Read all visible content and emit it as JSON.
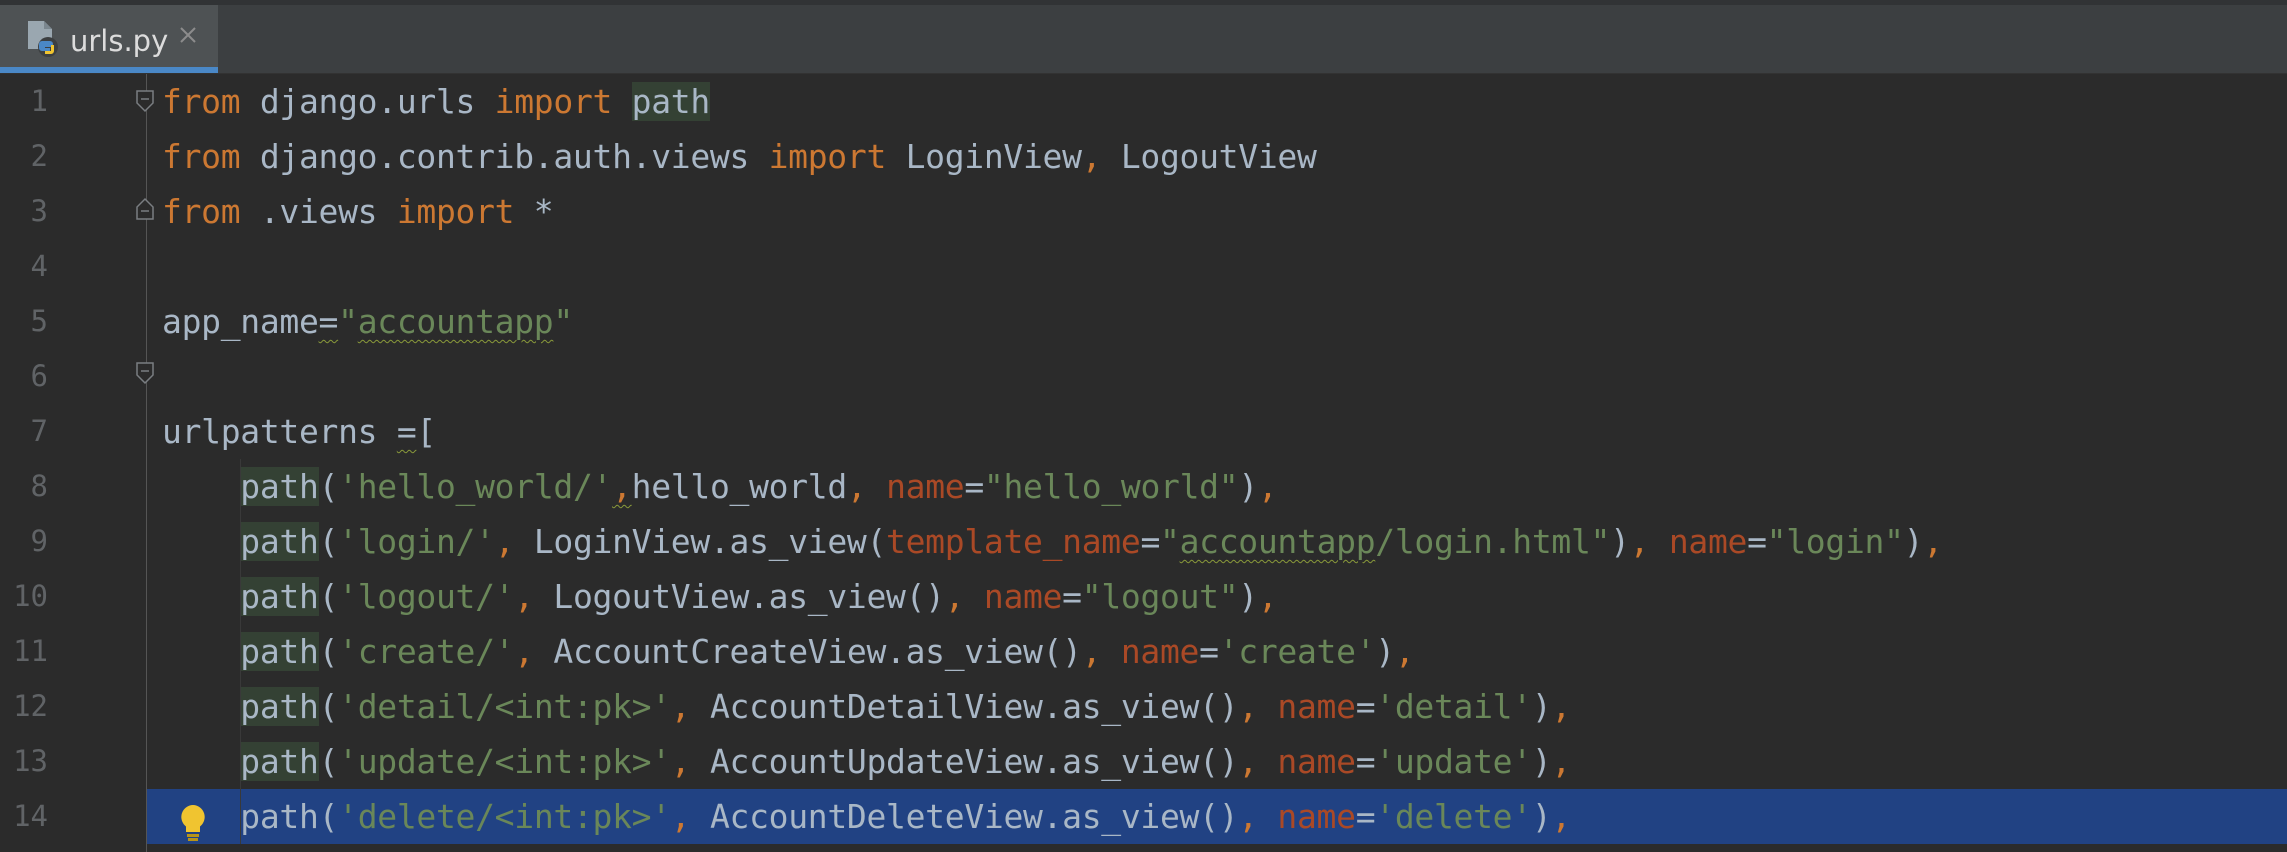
{
  "tab": {
    "filename": "urls.py",
    "icon": "python-file-icon",
    "close_glyph": "×"
  },
  "colors": {
    "background": "#2b2b2b",
    "keyword": "#cc7832",
    "string": "#6a8759",
    "param": "#aa4926",
    "identifier": "#a9b7c6",
    "selection": "#214283",
    "tab_accent": "#4a88c7"
  },
  "line_numbers": [
    "1",
    "2",
    "3",
    "4",
    "5",
    "6",
    "7",
    "8",
    "9",
    "10",
    "11",
    "12",
    "13",
    "14"
  ],
  "lines": [
    [
      {
        "t": "kw",
        "v": "from"
      },
      {
        "t": "id",
        "v": " django.urls "
      },
      {
        "t": "kw",
        "v": "import"
      },
      {
        "t": "id",
        "v": " "
      },
      {
        "t": "hl",
        "v": "path"
      }
    ],
    [
      {
        "t": "kw",
        "v": "from"
      },
      {
        "t": "id",
        "v": " django.contrib.auth.views "
      },
      {
        "t": "kw",
        "v": "import"
      },
      {
        "t": "id",
        "v": " LoginView"
      },
      {
        "t": "kw",
        "v": ","
      },
      {
        "t": "id",
        "v": " LogoutView"
      }
    ],
    [
      {
        "t": "kw",
        "v": "from"
      },
      {
        "t": "id",
        "v": " .views "
      },
      {
        "t": "kw",
        "v": "import"
      },
      {
        "t": "id",
        "v": " *"
      }
    ],
    [],
    [
      {
        "t": "id",
        "v": "app_name"
      },
      {
        "t": "sq",
        "v": "="
      },
      {
        "t": "str",
        "v": "\""
      },
      {
        "t": "strsq",
        "v": "accountapp"
      },
      {
        "t": "str",
        "v": "\""
      }
    ],
    [],
    [
      {
        "t": "id",
        "v": "urlpatterns "
      },
      {
        "t": "sq",
        "v": "="
      },
      {
        "t": "id",
        "v": "["
      }
    ],
    [
      {
        "t": "id",
        "v": "    "
      },
      {
        "t": "hl",
        "v": "path"
      },
      {
        "t": "id",
        "v": "("
      },
      {
        "t": "str",
        "v": "'hello_world/'"
      },
      {
        "t": "sqkw",
        "v": ","
      },
      {
        "t": "id",
        "v": "hello_world"
      },
      {
        "t": "kw",
        "v": ", "
      },
      {
        "t": "pn",
        "v": "name"
      },
      {
        "t": "id",
        "v": "="
      },
      {
        "t": "str",
        "v": "\"hello_world\""
      },
      {
        "t": "id",
        "v": ")"
      },
      {
        "t": "kw",
        "v": ","
      }
    ],
    [
      {
        "t": "id",
        "v": "    "
      },
      {
        "t": "hl",
        "v": "path"
      },
      {
        "t": "id",
        "v": "("
      },
      {
        "t": "str",
        "v": "'login/'"
      },
      {
        "t": "kw",
        "v": ", "
      },
      {
        "t": "id",
        "v": "LoginView.as_view("
      },
      {
        "t": "pn",
        "v": "template_name"
      },
      {
        "t": "id",
        "v": "="
      },
      {
        "t": "str",
        "v": "\""
      },
      {
        "t": "strsq",
        "v": "accountapp"
      },
      {
        "t": "str",
        "v": "/login.html\""
      },
      {
        "t": "id",
        "v": ")"
      },
      {
        "t": "kw",
        "v": ", "
      },
      {
        "t": "pn",
        "v": "name"
      },
      {
        "t": "id",
        "v": "="
      },
      {
        "t": "str",
        "v": "\"login\""
      },
      {
        "t": "id",
        "v": ")"
      },
      {
        "t": "kw",
        "v": ","
      }
    ],
    [
      {
        "t": "id",
        "v": "    "
      },
      {
        "t": "hl",
        "v": "path"
      },
      {
        "t": "id",
        "v": "("
      },
      {
        "t": "str",
        "v": "'logout/'"
      },
      {
        "t": "kw",
        "v": ", "
      },
      {
        "t": "id",
        "v": "LogoutView.as_view()"
      },
      {
        "t": "kw",
        "v": ", "
      },
      {
        "t": "pn",
        "v": "name"
      },
      {
        "t": "id",
        "v": "="
      },
      {
        "t": "str",
        "v": "\"logout\""
      },
      {
        "t": "id",
        "v": ")"
      },
      {
        "t": "kw",
        "v": ","
      }
    ],
    [
      {
        "t": "id",
        "v": "    "
      },
      {
        "t": "hl",
        "v": "path"
      },
      {
        "t": "id",
        "v": "("
      },
      {
        "t": "str",
        "v": "'create/'"
      },
      {
        "t": "kw",
        "v": ", "
      },
      {
        "t": "id",
        "v": "AccountCreateView.as_view()"
      },
      {
        "t": "kw",
        "v": ", "
      },
      {
        "t": "pn",
        "v": "name"
      },
      {
        "t": "id",
        "v": "="
      },
      {
        "t": "str",
        "v": "'create'"
      },
      {
        "t": "id",
        "v": ")"
      },
      {
        "t": "kw",
        "v": ","
      }
    ],
    [
      {
        "t": "id",
        "v": "    "
      },
      {
        "t": "hl",
        "v": "path"
      },
      {
        "t": "id",
        "v": "("
      },
      {
        "t": "str",
        "v": "'detail/<int:pk>'"
      },
      {
        "t": "kw",
        "v": ", "
      },
      {
        "t": "id",
        "v": "AccountDetailView.as_view()"
      },
      {
        "t": "kw",
        "v": ", "
      },
      {
        "t": "pn",
        "v": "name"
      },
      {
        "t": "id",
        "v": "="
      },
      {
        "t": "str",
        "v": "'detail'"
      },
      {
        "t": "id",
        "v": ")"
      },
      {
        "t": "kw",
        "v": ","
      }
    ],
    [
      {
        "t": "id",
        "v": "    "
      },
      {
        "t": "hl",
        "v": "path"
      },
      {
        "t": "id",
        "v": "("
      },
      {
        "t": "str",
        "v": "'update/<int:pk>'"
      },
      {
        "t": "kw",
        "v": ", "
      },
      {
        "t": "id",
        "v": "AccountUpdateView.as_view()"
      },
      {
        "t": "kw",
        "v": ", "
      },
      {
        "t": "pn",
        "v": "name"
      },
      {
        "t": "id",
        "v": "="
      },
      {
        "t": "str",
        "v": "'update'"
      },
      {
        "t": "id",
        "v": ")"
      },
      {
        "t": "kw",
        "v": ","
      }
    ],
    [
      {
        "t": "id",
        "v": "    "
      },
      {
        "t": "id",
        "v": "path"
      },
      {
        "t": "id",
        "v": "("
      },
      {
        "t": "str",
        "v": "'delete/<int:pk>'"
      },
      {
        "t": "kw",
        "v": ", "
      },
      {
        "t": "id",
        "v": "AccountDeleteView.as_view()"
      },
      {
        "t": "kw",
        "v": ", "
      },
      {
        "t": "pn",
        "v": "name"
      },
      {
        "t": "id",
        "v": "="
      },
      {
        "t": "str",
        "v": "'delete'"
      },
      {
        "t": "id",
        "v": ")"
      },
      {
        "t": "kw",
        "v": ","
      }
    ]
  ],
  "selected_line": 14,
  "fold_markers": [
    "line-1",
    "line-3",
    "line-7"
  ],
  "gutter_icons": {
    "line-14": "lightbulb-icon"
  }
}
